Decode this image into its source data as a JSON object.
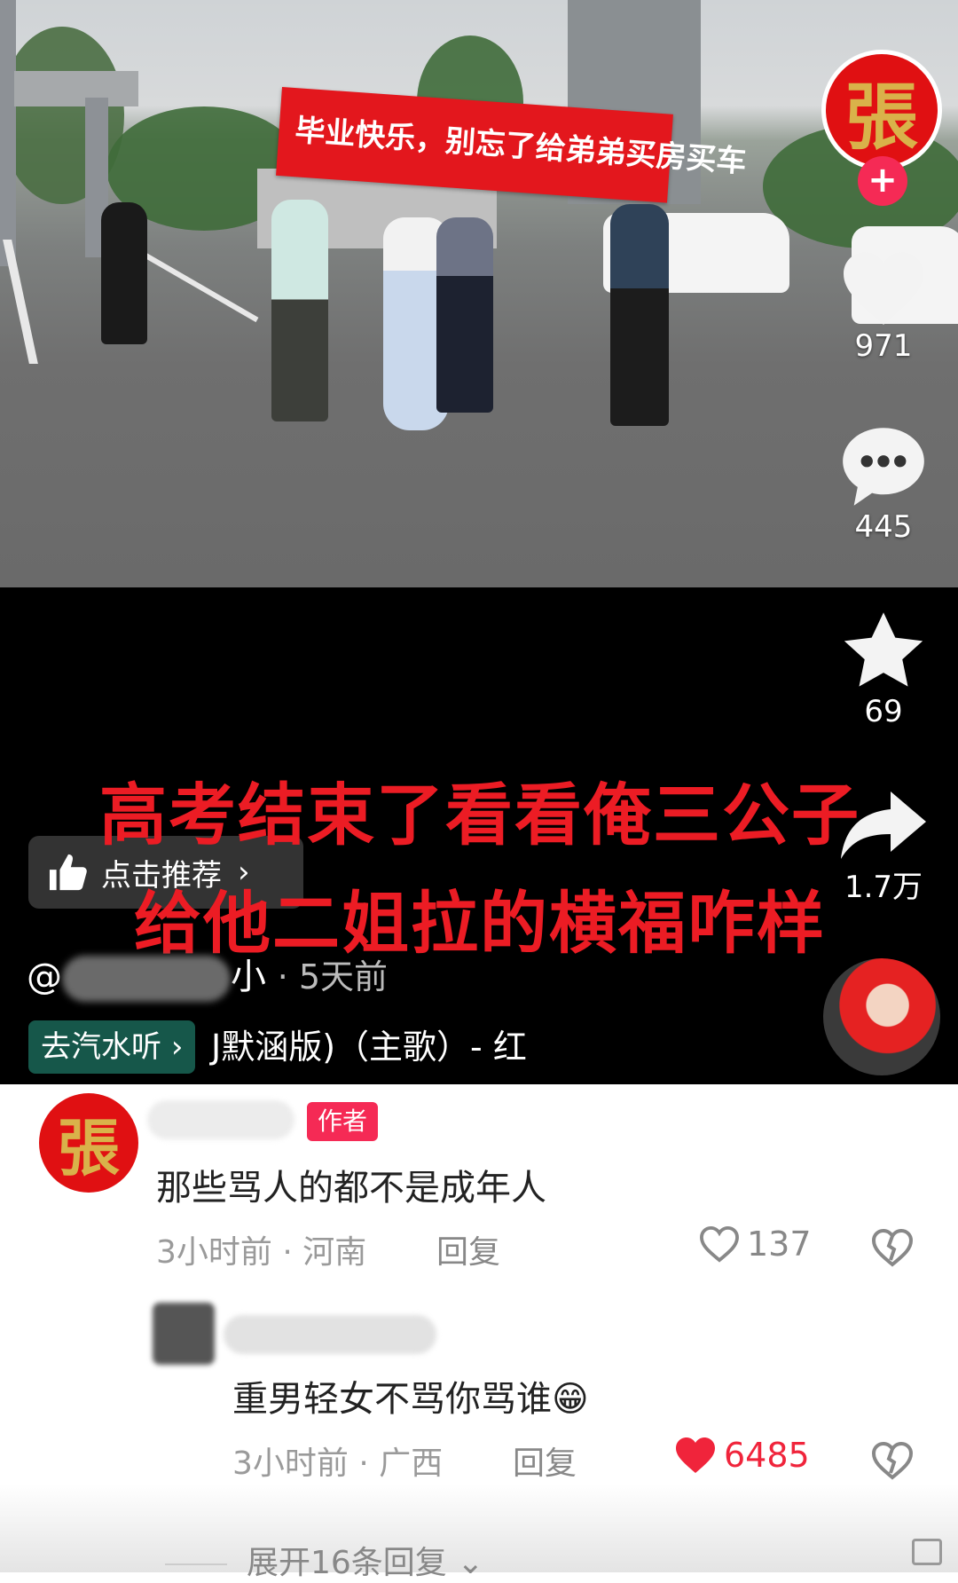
{
  "video": {
    "banner_text": "毕业快乐，别忘了给弟弟买房买车",
    "caption": "高考结束了看看俺三公子给他二姐拉的横福咋样",
    "recommend_label": "点击推荐",
    "author_prefix": "@",
    "author_suffix": "小",
    "post_time": "· 5天前",
    "music_button": "去汽水听",
    "music_text": "J默涵版)（主歌）- 红",
    "avatar_glyph": "張"
  },
  "side_actions": {
    "likes": "971",
    "comments": "445",
    "favorites": "69",
    "shares": "1.7万"
  },
  "comments": [
    {
      "avatar_glyph": "張",
      "badge": "作者",
      "text": "那些骂人的都不是成年人",
      "time": "3小时前",
      "location": "· 河南",
      "reply_label": "回复",
      "likes": "137",
      "liked": false
    },
    {
      "text": "重男轻女不骂你骂谁😁",
      "time": "3小时前",
      "location": "· 广西",
      "reply_label": "回复",
      "likes": "6485",
      "liked": true
    }
  ],
  "expand_replies": "展开16条回复",
  "colors": {
    "accent_pink": "#f52a55",
    "like_red": "#f0243b",
    "caption_red": "#ec1c24",
    "music_green": "#16574a"
  }
}
